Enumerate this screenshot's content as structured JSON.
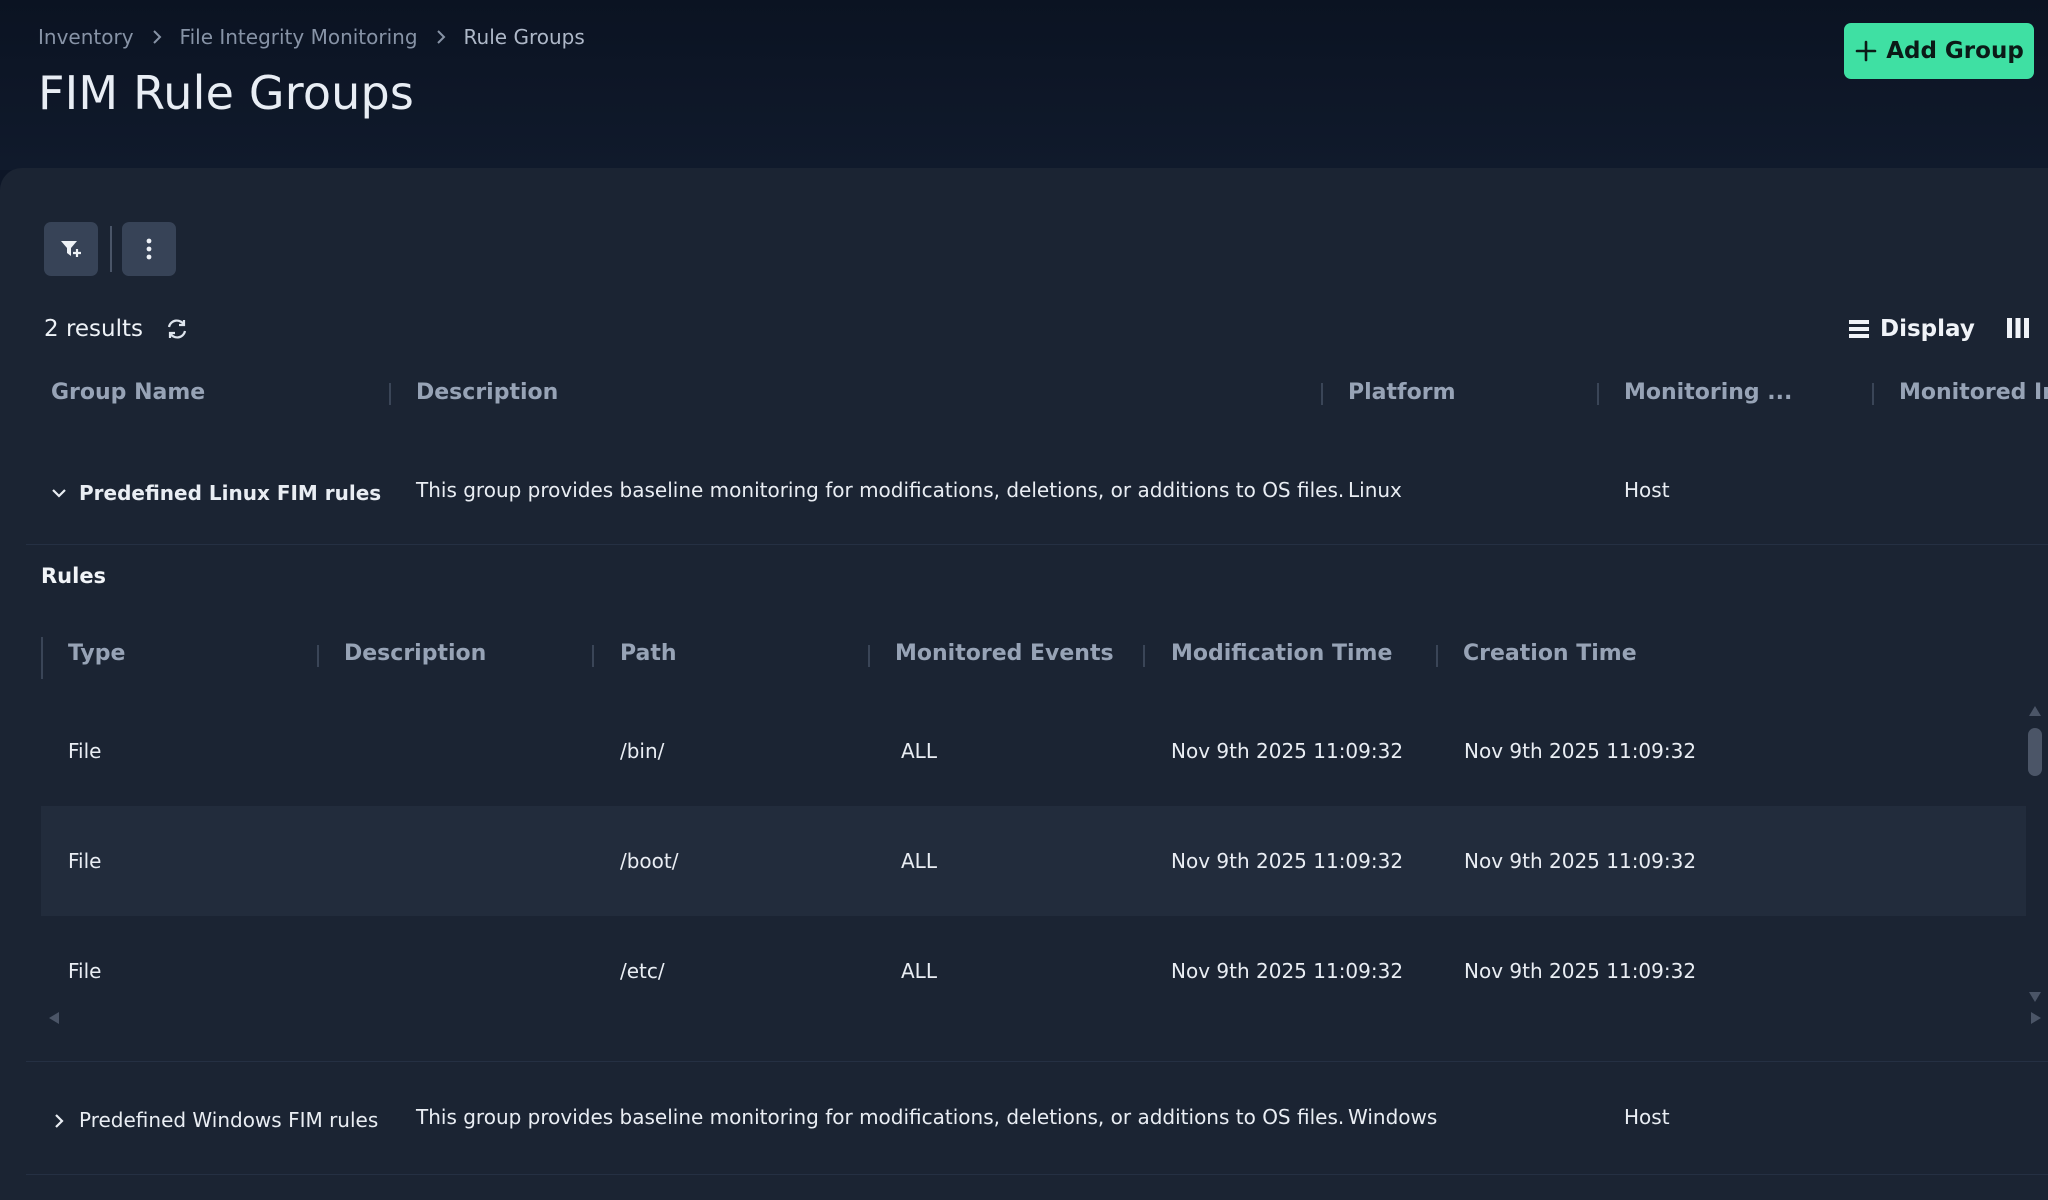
{
  "breadcrumb": {
    "items": [
      "Inventory",
      "File Integrity Monitoring",
      "Rule Groups"
    ]
  },
  "page": {
    "title": "FIM Rule Groups",
    "add_button_label": "Add Group"
  },
  "toolbar": {
    "filter_icon": "filter-plus-icon",
    "more_icon": "more-vertical-icon"
  },
  "results": {
    "count_label": "2 results",
    "display_label": "Display"
  },
  "table": {
    "columns": [
      "Group Name",
      "Description",
      "Platform",
      "Monitoring ...",
      "Monitored Im"
    ],
    "groups": [
      {
        "name": "Predefined Linux FIM rules",
        "description": "This group provides baseline monitoring for modifications, deletions, or additions to OS files.",
        "platform": "Linux",
        "monitoring": "Host",
        "expanded": true
      },
      {
        "name": "Predefined Windows FIM rules",
        "description": "This group provides baseline monitoring for modifications, deletions, or additions to OS files.",
        "platform": "Windows",
        "monitoring": "Host",
        "expanded": false
      }
    ]
  },
  "rules": {
    "title": "Rules",
    "columns": [
      "Type",
      "Description",
      "Path",
      "Monitored Events",
      "Modification Time",
      "Creation Time"
    ],
    "rows": [
      {
        "type": "File",
        "description": "",
        "path": "/bin/",
        "events": "ALL",
        "modified": "Nov 9th 2025 11:09:32",
        "created": "Nov 9th 2025 11:09:32"
      },
      {
        "type": "File",
        "description": "",
        "path": "/boot/",
        "events": "ALL",
        "modified": "Nov 9th 2025 11:09:32",
        "created": "Nov 9th 2025 11:09:32"
      },
      {
        "type": "File",
        "description": "",
        "path": "/etc/",
        "events": "ALL",
        "modified": "Nov 9th 2025 11:09:32",
        "created": "Nov 9th 2025 11:09:32"
      }
    ]
  },
  "colors": {
    "accent": "#3fe0a3",
    "background": "#0d1627",
    "panel": "#1b2433"
  }
}
